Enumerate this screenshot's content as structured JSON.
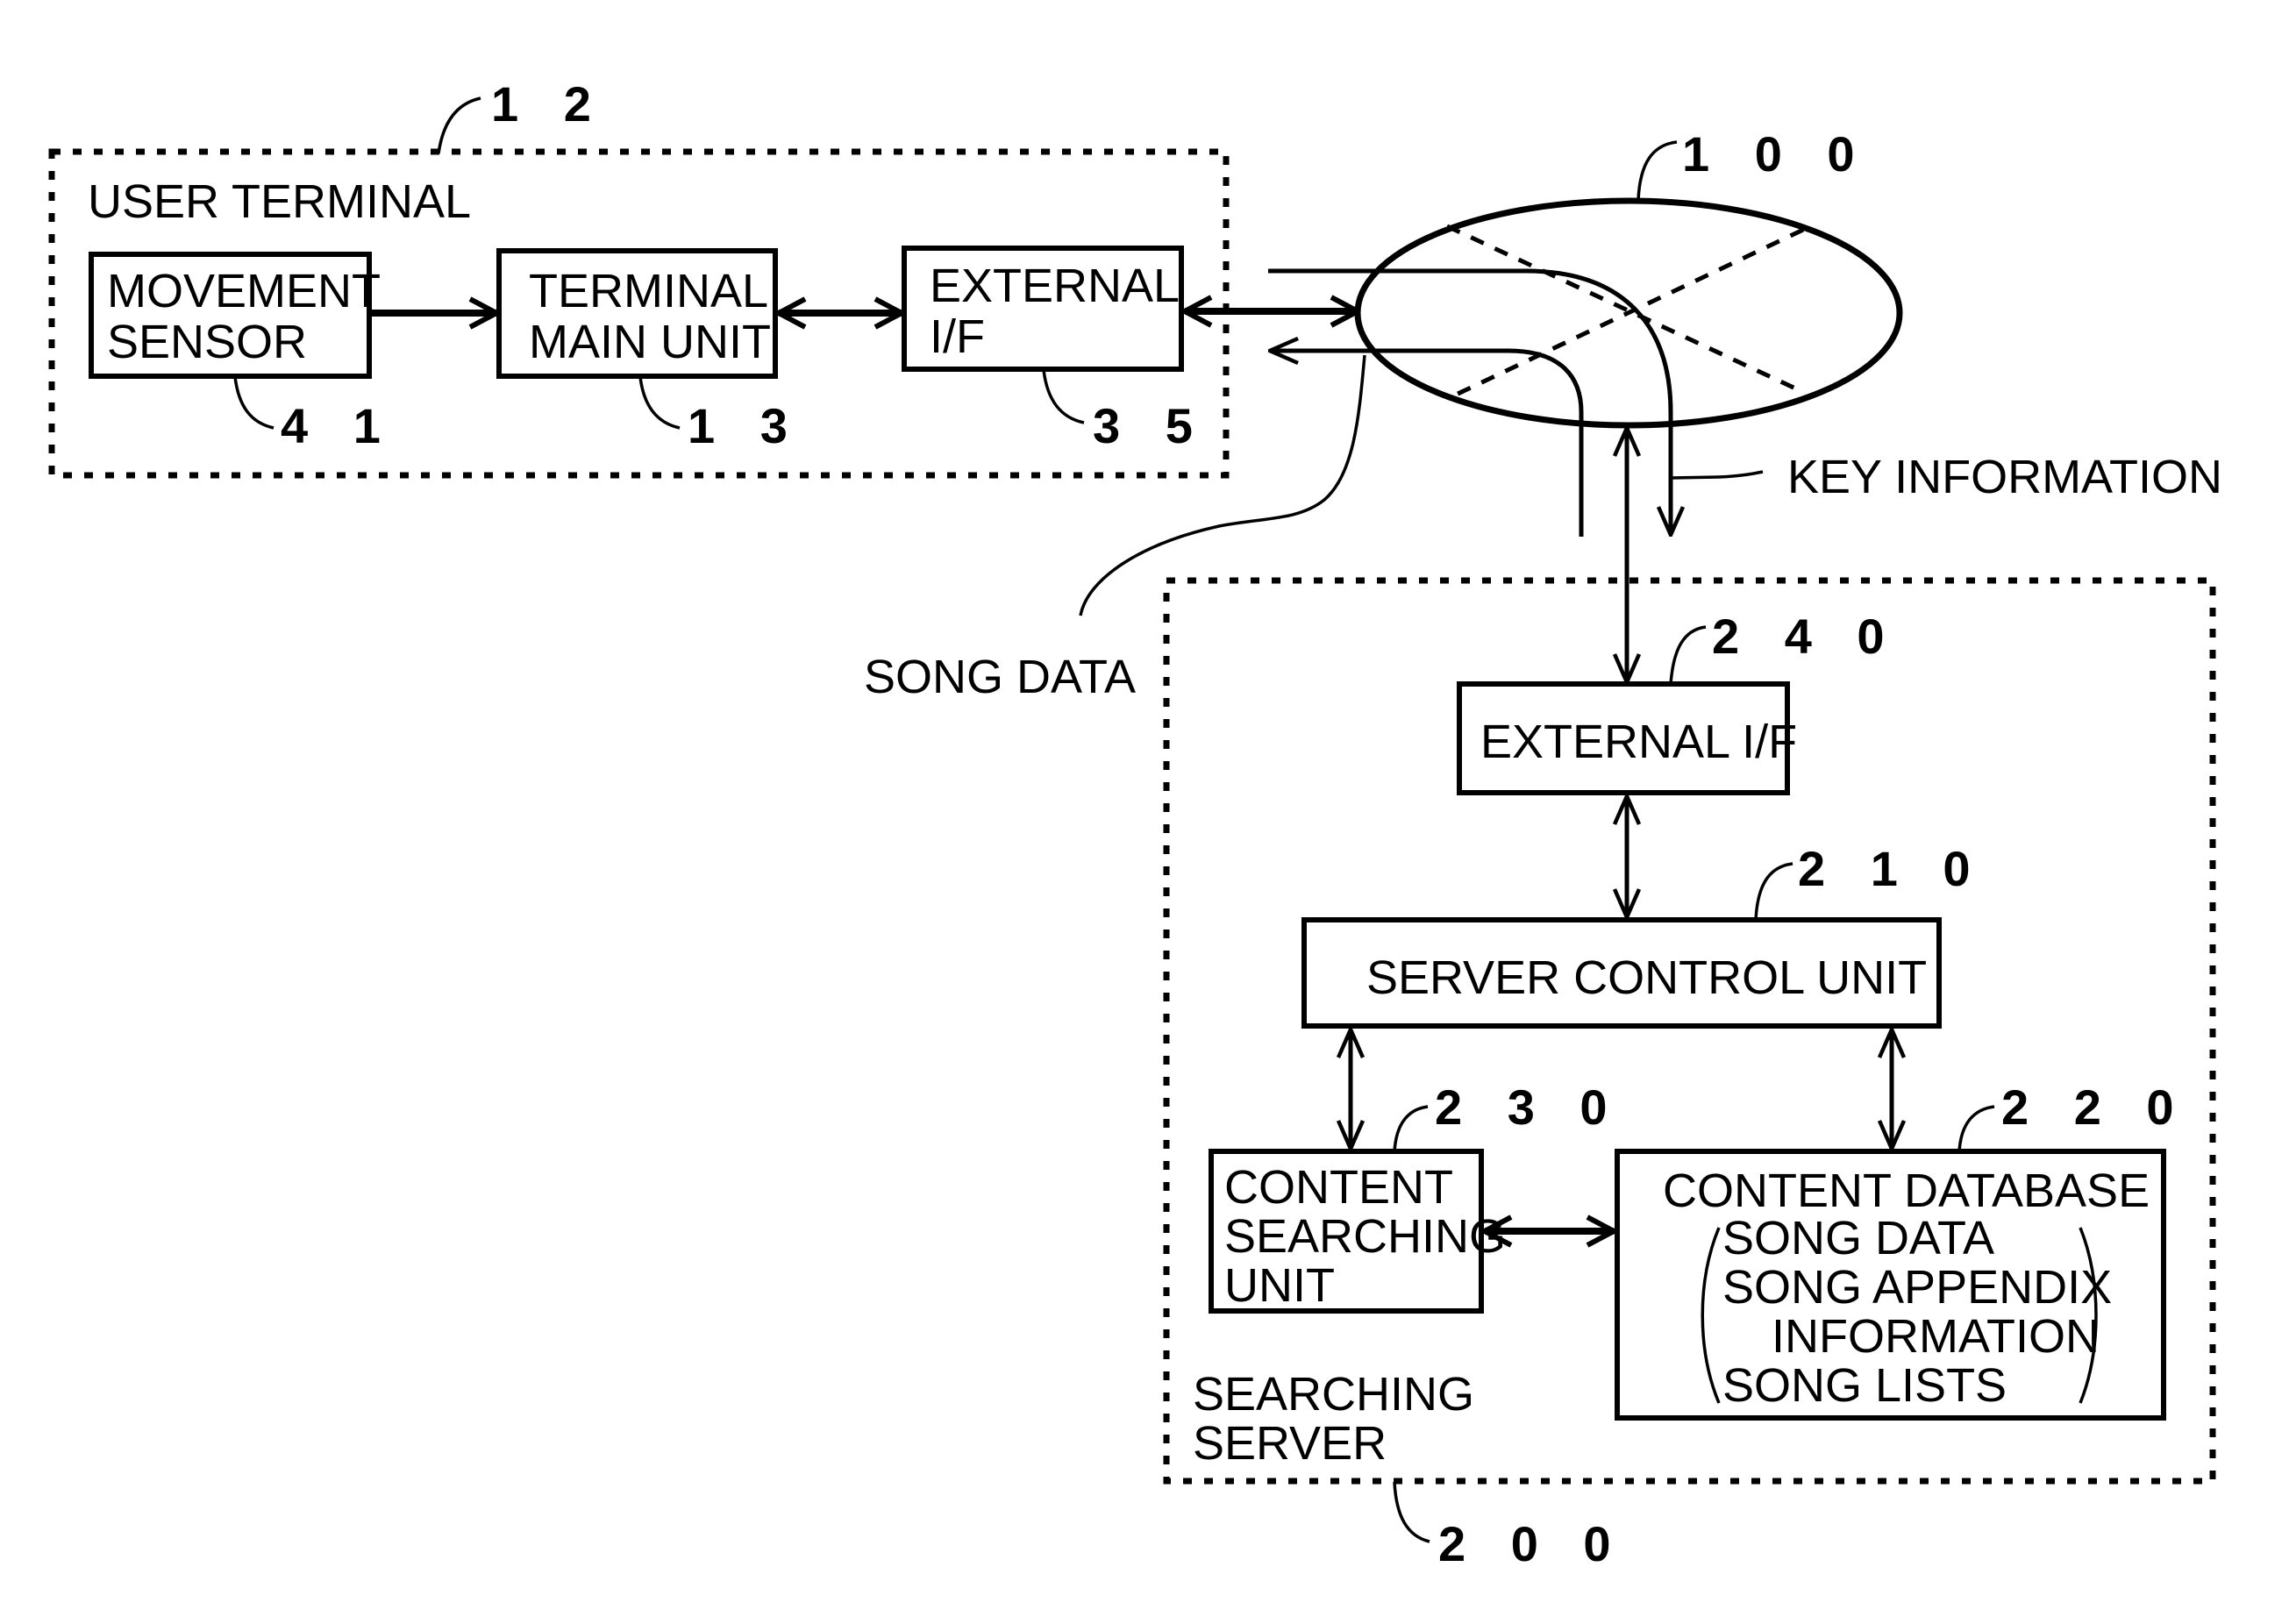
{
  "user_terminal": {
    "title": "USER TERMINAL",
    "ref": "1 2",
    "movement_sensor": {
      "lines": [
        "MOVEMENT",
        "SENSOR"
      ],
      "ref": "4 1"
    },
    "terminal_main_unit": {
      "lines": [
        "TERMINAL",
        "MAIN UNIT"
      ],
      "ref": "1 3"
    },
    "external_if": {
      "lines": [
        "EXTERNAL",
        "I/F"
      ],
      "ref": "3 5"
    }
  },
  "network": {
    "ref": "1 0 0"
  },
  "labels": {
    "key_information": "KEY INFORMATION",
    "song_data": "SONG DATA"
  },
  "searching_server": {
    "title_lines": [
      "SEARCHING",
      "SERVER"
    ],
    "ref": "2 0 0",
    "external_if": {
      "label": "EXTERNAL I/F",
      "ref": "2 4 0"
    },
    "server_control_unit": {
      "label": "SERVER CONTROL UNIT",
      "ref": "2 1 0"
    },
    "content_searching_unit": {
      "lines": [
        "CONTENT",
        "SEARCHING",
        "UNIT"
      ],
      "ref": "2 3 0"
    },
    "content_database": {
      "title": "CONTENT DATABASE",
      "items": [
        "SONG DATA",
        "SONG APPENDIX",
        "INFORMATION",
        "SONG LISTS"
      ],
      "ref": "2 2 0"
    }
  }
}
